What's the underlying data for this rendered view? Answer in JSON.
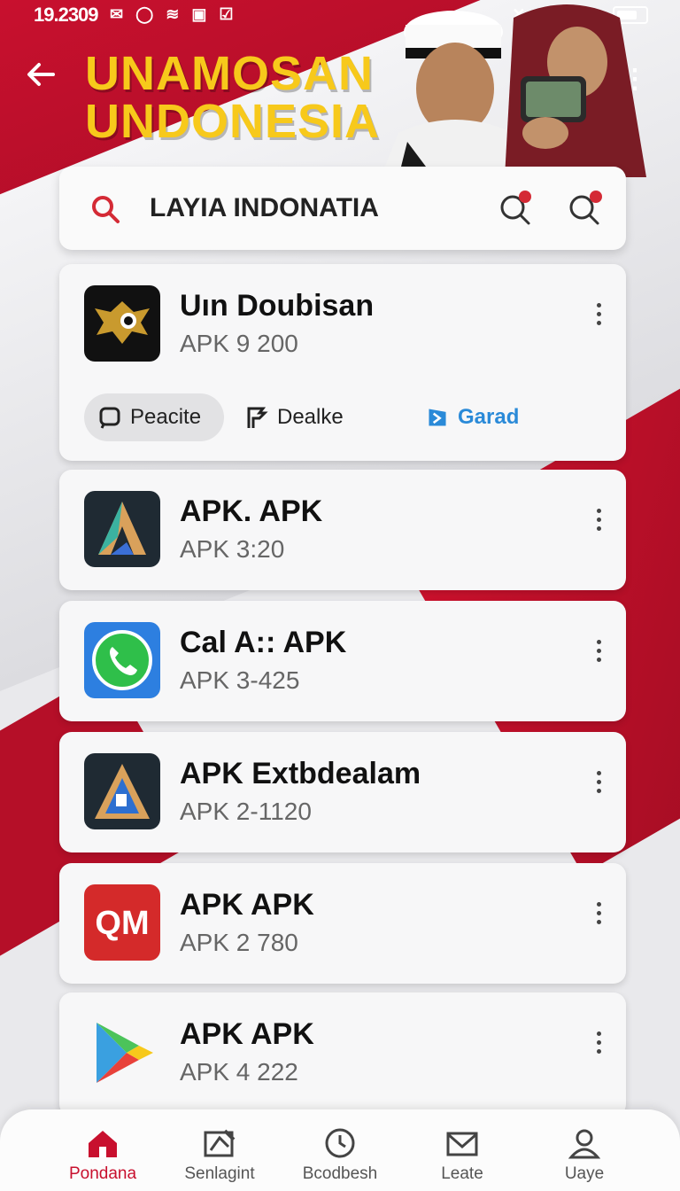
{
  "status_bar": {
    "time": "19.2309"
  },
  "header": {
    "title_line1": "UNAMOSAN",
    "title_line2": "UNDONESIA"
  },
  "search": {
    "query": "LAYIA INDONATIA"
  },
  "featured": {
    "name": "Uın Doubisan",
    "subtitle": "APK 9 200",
    "actions": [
      {
        "label": "Peacite",
        "selected": true
      },
      {
        "label": "Dealke",
        "selected": false
      },
      {
        "label": "Garad",
        "selected": false
      }
    ]
  },
  "apps": [
    {
      "name": "APK. APK",
      "subtitle": "APK 3:20",
      "icon": "apk-a-icon"
    },
    {
      "name": "Cal A:: APK",
      "subtitle": "APK 3-425",
      "icon": "phone-call-icon"
    },
    {
      "name": "APK Extbdealam",
      "subtitle": "APK 2-1120",
      "icon": "apk-extb-icon"
    },
    {
      "name": "APK APK",
      "subtitle": "APK 2 780",
      "icon": "om-icon"
    },
    {
      "name": "APK APK",
      "subtitle": "APK 4 222",
      "icon": "play-store-icon"
    }
  ],
  "nav": [
    {
      "label": "Pondana",
      "icon": "home-icon",
      "active": true
    },
    {
      "label": "Senlagint",
      "icon": "image-edit-icon",
      "active": false
    },
    {
      "label": "Bcodbesh",
      "icon": "clock-icon",
      "active": false
    },
    {
      "label": "Leate",
      "icon": "mail-icon",
      "active": false
    },
    {
      "label": "Uaye",
      "icon": "user-icon",
      "active": false
    }
  ],
  "colors": {
    "brand_red": "#c8102e",
    "title_yellow": "#f7c91b",
    "link_blue": "#2a8ad8"
  }
}
